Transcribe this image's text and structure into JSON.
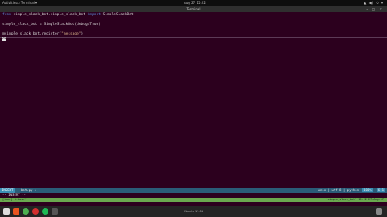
{
  "topbar": {
    "activities": "Activities",
    "app_menu": "☐ Terminal ▾",
    "clock": "Aug 27 15:22",
    "tray": "▲ ◀) ⏻ ▾"
  },
  "window": {
    "title": "Terminal",
    "controls": "– ▢ ✕"
  },
  "editor": {
    "lines": [
      {
        "kw1": "from",
        "mid1": " simple_slack_bot.simple_slack_bot ",
        "kw2": "import",
        "rest": " SimpleSlackBot"
      },
      {
        "text": ""
      },
      {
        "text": "simple_slack_bot = SimpleSlackBot(debug=True)"
      },
      {
        "text": ""
      },
      {
        "pre": "@simple_slack_bot.register(",
        "str": "\"message\"",
        "post": ")"
      },
      {
        "cursor": "de",
        "text": ""
      }
    ]
  },
  "statusbar": {
    "mode": "INSERT",
    "file": "bot.py  +",
    "encoding": "unix | utf-8 | python",
    "percent": "100%",
    "position": "6:1"
  },
  "cmdline": {
    "text": "-- INSERT --"
  },
  "greenbar": {
    "left": "[tmux]  0:bash*",
    "right": "\"simple_slack_bot\" 15:22 27-Aug-17"
  },
  "taskbar": {
    "center": "Ubuntu 17.04"
  },
  "colors": {
    "background": "#2c001e",
    "statusbar": "#2a5c78",
    "accent": "#3c8fb5",
    "tmux": "#6aa84f"
  }
}
